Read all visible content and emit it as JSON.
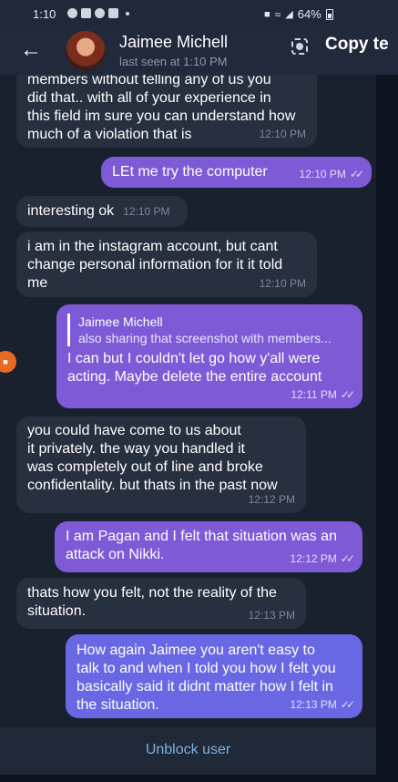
{
  "status_bar": {
    "time": "1:10",
    "battery": "64%"
  },
  "header": {
    "contact_name": "Jaimee Michell",
    "last_seen": "last seen at 1:10 PM",
    "copy_text_label": "Copy te"
  },
  "messages": [
    {
      "direction": "in",
      "text": "members without telling any of us you\ndid that.. with all of your experience in\nthis field im sure you can understand how\nmuch of a violation that is",
      "time": "12:10 PM"
    },
    {
      "direction": "out",
      "text": "LEt me try the computer",
      "time": "12:10 PM"
    },
    {
      "direction": "in",
      "text": "interesting ok",
      "time": "12:10 PM"
    },
    {
      "direction": "in",
      "text": "i am in the instagram account, but cant\nchange personal information for it it told\nme",
      "time": "12:10 PM"
    },
    {
      "direction": "out",
      "reply_name": "Jaimee Michell",
      "reply_snippet": "also sharing that screenshot with members...",
      "text": "I can but I couldn't let go how y'all were\nacting. Maybe delete the entire account",
      "time": "12:11 PM"
    },
    {
      "direction": "in",
      "text": "you could have come to us about\nit privately. the way you handled it\nwas completely out of line and broke\nconfidentality. but thats in the past now",
      "time": "12:12 PM"
    },
    {
      "direction": "out",
      "text": "I am Pagan and I felt that situation was an\nattack on Nikki.",
      "time": "12:12 PM"
    },
    {
      "direction": "in",
      "text": "thats how you felt, not the reality of the\nsituation.",
      "time": "12:13 PM"
    },
    {
      "direction": "out",
      "text": "How again Jaimee you aren't easy to\ntalk to and when I told you how I felt you\nbasically said it didnt matter how I felt in\nthe situation.",
      "time": "12:13 PM"
    }
  ],
  "side_badge_icon": "screen-record-icon",
  "bottom": {
    "unblock_label": "Unblock user"
  },
  "colors": {
    "incoming_bubble": "#26303f",
    "outgoing_bubble": "#7e5ad6",
    "outgoing_bubble_last": "#6a67e4",
    "unblock_link": "#7fb0dd"
  }
}
